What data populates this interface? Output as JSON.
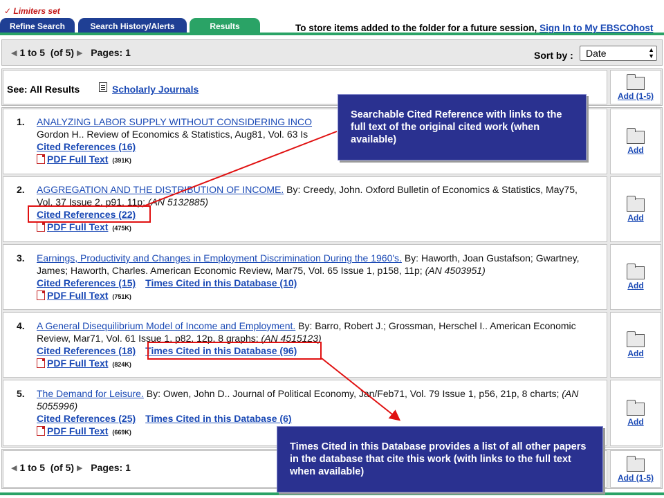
{
  "limiters": "✓ Limiters set",
  "tabs": [
    {
      "label": "Refine Search"
    },
    {
      "label": "Search History/Alerts"
    },
    {
      "label": "Results"
    }
  ],
  "store_message": {
    "text": "To store items added to the folder for a future session,",
    "link": "Sign In to My EBSCOhost"
  },
  "pager": {
    "range": "1 to 5",
    "total": "(of 5)",
    "pages_label": "Pages:",
    "page": "1"
  },
  "sort": {
    "label": "Sort by :",
    "value": "Date"
  },
  "see": {
    "label": "See: All Results",
    "journal_link": "Scholarly Journals"
  },
  "add": {
    "range_label": "Add (1-5)",
    "item_label": "Add"
  },
  "results": [
    {
      "num": "1.",
      "title": "ANALYZING LABOR SUPPLY WITHOUT CONSIDERING INCO",
      "rest": "Gordon H.. Review of Economics & Statistics, Aug81, Vol. 63 Is",
      "an": "",
      "cited": "Cited References (16)",
      "times": "",
      "pdf": "PDF Full Text",
      "size": "(391K)"
    },
    {
      "num": "2.",
      "title": "AGGREGATION AND THE DISTRIBUTION OF INCOME.",
      "rest": " By: Creedy, John. Oxford Bulletin of Economics & Statistics, May75, Vol. 37 Issue 2, p91, 11p; ",
      "an": "(AN 5132885)",
      "cited": "Cited References (22)",
      "times": "",
      "pdf": "PDF Full Text",
      "size": "(475K)"
    },
    {
      "num": "3.",
      "title": "Earnings, Productivity and Changes in Employment Discrimination During the 1960's.",
      "rest": " By: Haworth, Joan Gustafson; Gwartney, James; Haworth, Charles. American Economic Review, Mar75, Vol. 65 Issue 1, p158, 11p; ",
      "an": "(AN 4503951)",
      "cited": "Cited References (15)",
      "times": "Times Cited in this Database (10)",
      "pdf": "PDF Full Text",
      "size": "(751K)"
    },
    {
      "num": "4.",
      "title": "A General Disequilibrium Model of Income and Employment.",
      "rest": " By: Barro, Robert J.; Grossman, Herschel I.. American Economic Review, Mar71, Vol. 61 Issue 1, p82, 12p, 8 graphs; ",
      "an": "(AN 4515123)",
      "cited": "Cited References (18)",
      "times": "Times Cited in this Database (96)",
      "pdf": "PDF Full Text",
      "size": "(824K)"
    },
    {
      "num": "5.",
      "title": "The Demand for Leisure.",
      "rest": " By: Owen, John D.. Journal of Political Economy, Jan/Feb71, Vol. 79 Issue 1, p56, 21p, 8 charts; ",
      "an": "(AN 5055996)",
      "cited": "Cited References (25)",
      "times": "Times Cited in this Database (6)",
      "pdf": "PDF Full Text",
      "size": "(669K)"
    }
  ],
  "callouts": {
    "cited_reference": "Searchable Cited Reference with links to the full text of the original cited work (when available)",
    "times_cited": "Times Cited in this Database provides a list of all other papers in the database that cite this work (with links to the full text when available)"
  },
  "colors": {
    "tab_blue": "#1f3f94",
    "tab_green": "#2aa366",
    "link": "#1a49b5",
    "callout": "#2a3190",
    "highlight": "#e01010"
  }
}
